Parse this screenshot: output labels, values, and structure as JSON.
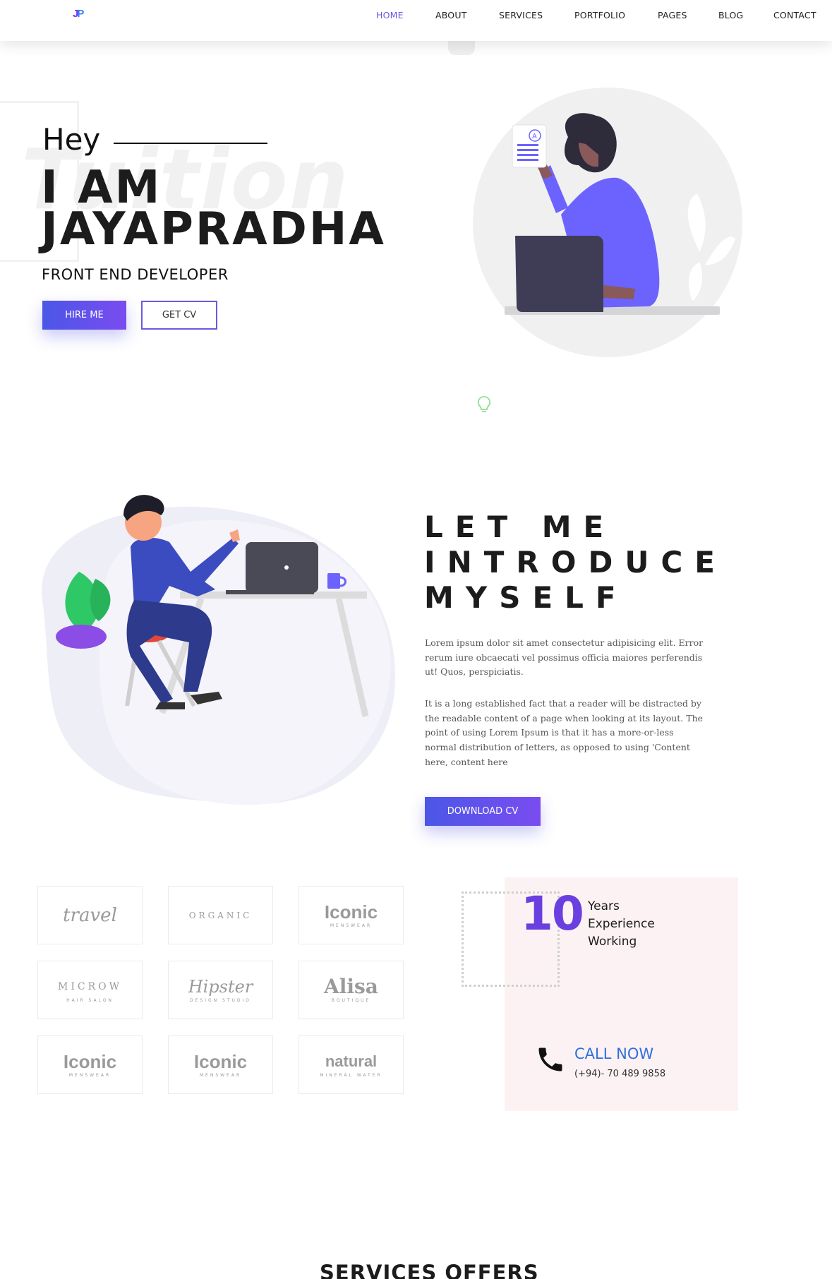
{
  "nav": {
    "logo_j": "J",
    "logo_p": "P",
    "links": [
      "HOME",
      "ABOUT",
      "SERVICES",
      "PORTFOLIO",
      "PAGES",
      "BLOG",
      "CONTACT"
    ]
  },
  "hero": {
    "watermark": "Tuition",
    "greeting": "Hey",
    "name_line1": "I AM",
    "name_line2": "JAYAPRADHA",
    "role": "FRONT END DEVELOPER",
    "hire_label": "HIRE ME",
    "cv_label": "GET CV"
  },
  "about": {
    "title_lines": [
      "LET ME",
      "INTRODUCE",
      "MYSELF"
    ],
    "paragraph1": "Lorem ipsum dolor sit amet consectetur adipisicing elit. Error rerum iure obcaecati vel possimus officia maiores perferendis ut! Quos, perspiciatis.",
    "paragraph2": "It is a long established fact that a reader will be distracted by the readable content of a page when looking at its layout. The point of using Lorem Ipsum is that it has a more-or-less normal distribution of letters, as opposed to using 'Content here, content here",
    "download_label": "DOWNLOAD CV"
  },
  "clients": [
    {
      "main": "travel",
      "sub": ""
    },
    {
      "main": "ORGANIC",
      "sub": ""
    },
    {
      "main": "Iconic",
      "sub": "MENSWEAR"
    },
    {
      "main": "MICROW",
      "sub": "HAIR SALON"
    },
    {
      "main": "Hipster",
      "sub": "DESIGN STUDIO"
    },
    {
      "main": "Alisa",
      "sub": "BOUTIQUE"
    },
    {
      "main": "Iconic",
      "sub": "MENSWEAR"
    },
    {
      "main": "Iconic",
      "sub": "MENSWEAR"
    },
    {
      "main": "natural",
      "sub": "MINERAL WATER"
    }
  ],
  "experience": {
    "years": "10",
    "line1": "Years",
    "line2": "Experience",
    "line3": "Working",
    "call_label": "CALL NOW",
    "phone": "(+94)- 70 489 9858"
  },
  "services": {
    "title": "SERVICES OFFERS"
  },
  "colors": {
    "accent": "#6a5ae0",
    "brand_purple": "#6a3fe0",
    "call_blue": "#2f6fe0"
  }
}
